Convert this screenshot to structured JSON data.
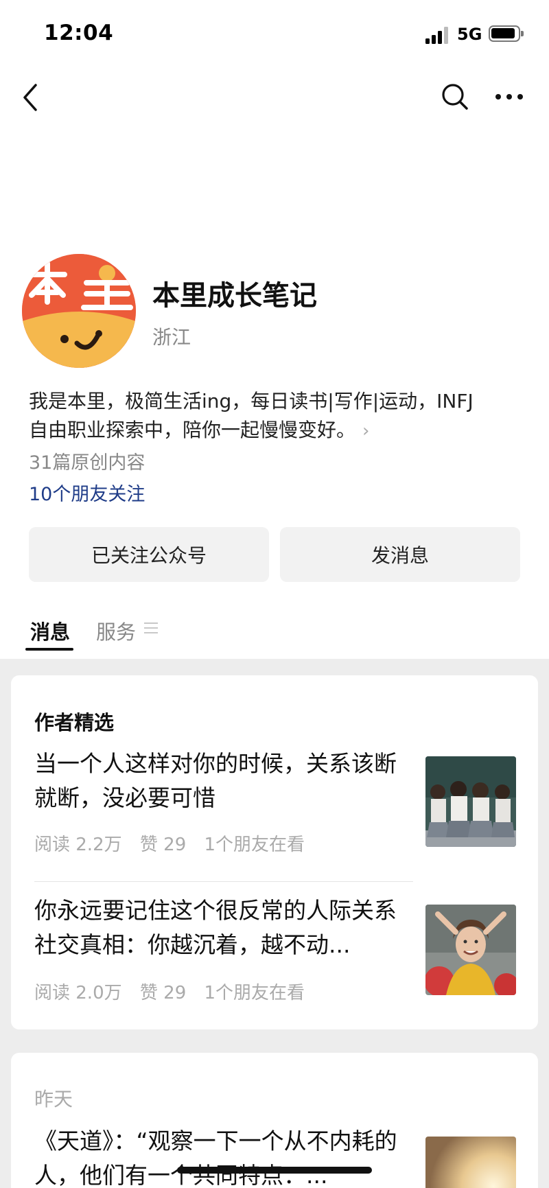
{
  "status_bar": {
    "time": "12:04",
    "network": "5G"
  },
  "profile": {
    "name": "本里成长笔记",
    "region": "浙江",
    "bio_line1": "我是本里，极简生活ing，每日读书|写作|运动，INFJ",
    "bio_line2": "自由职业探索中，陪你一起慢慢变好。",
    "original_count": "31篇原创内容",
    "friends_follow": "10个朋友关注"
  },
  "actions": {
    "followed_label": "已关注公众号",
    "message_label": "发消息"
  },
  "tabs": {
    "messages": "消息",
    "services": "服务"
  },
  "featured": {
    "header": "作者精选",
    "articles": [
      {
        "title": "当一个人这样对你的时候，关系该断就断，没必要可惜",
        "reads": "阅读 2.2万",
        "likes": "赞 29",
        "friends": "1个朋友在看"
      },
      {
        "title": "你永远要记住这个很反常的人际关系社交真相：你越沉着，越不动...",
        "reads": "阅读 2.0万",
        "likes": "赞 29",
        "friends": "1个朋友在看"
      }
    ]
  },
  "yesterday": {
    "header": "昨天",
    "article_title": "《天道》：“观察一下一个从不内耗的人，他们有一个共同特点：..."
  },
  "colors": {
    "link": "#1f3c88",
    "feed_bg": "#ededed",
    "avatar": "#ec5b3a"
  }
}
